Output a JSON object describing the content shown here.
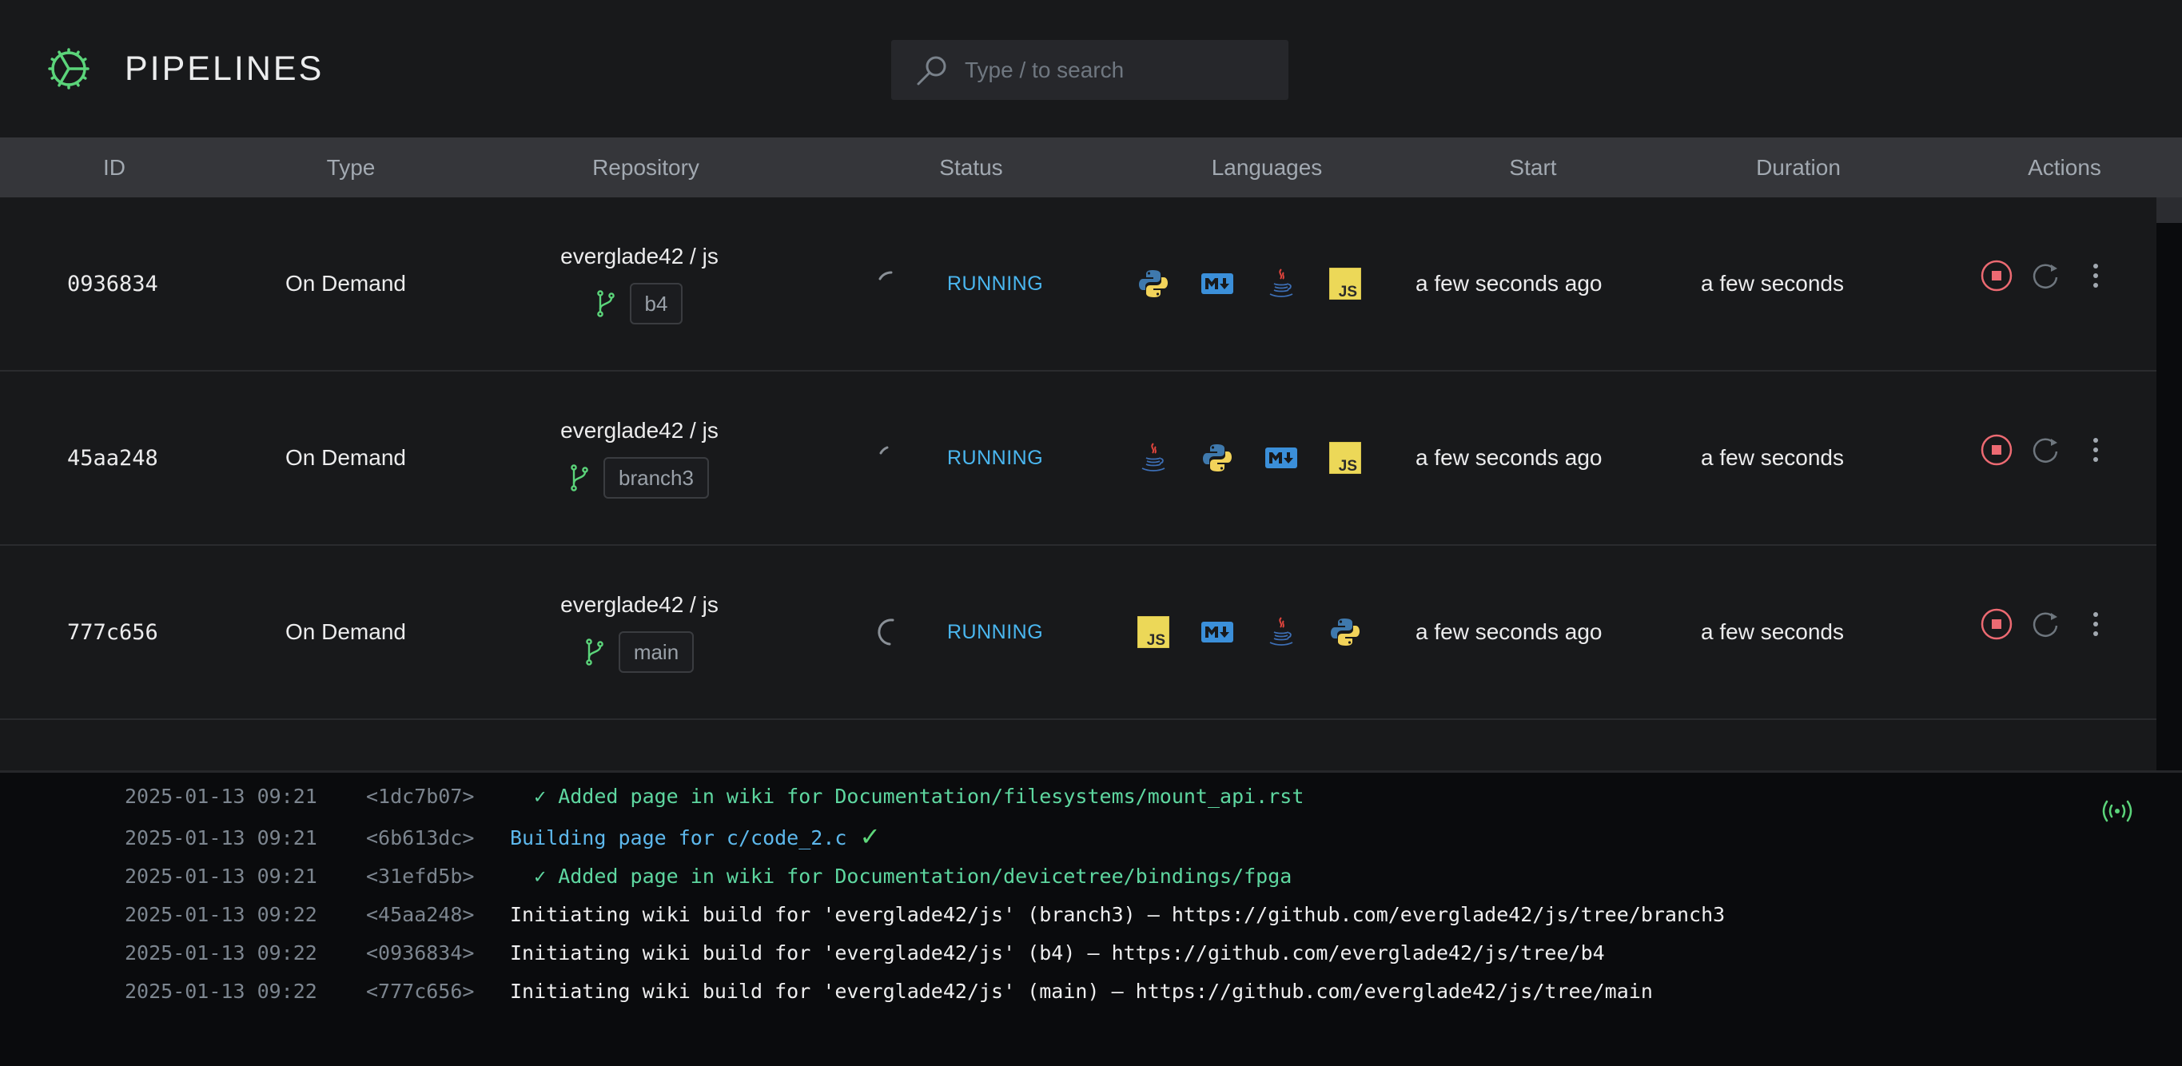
{
  "app": {
    "title": "PIPELINES",
    "logo_icon": "gear-icon",
    "accent_color": "#5bd47a"
  },
  "search": {
    "placeholder": "Type / to search",
    "value": "",
    "icon": "search-icon"
  },
  "table": {
    "columns": [
      "ID",
      "Type",
      "Repository",
      "Status",
      "Languages",
      "Start",
      "Duration",
      "Actions"
    ],
    "rows": [
      {
        "id": "0936834",
        "type": "On Demand",
        "repository": "everglade42 / js",
        "branch": "b4",
        "status": "RUNNING",
        "languages": [
          "python",
          "markdown",
          "java",
          "javascript"
        ],
        "start": "a few seconds ago",
        "duration": "a few seconds"
      },
      {
        "id": "45aa248",
        "type": "On Demand",
        "repository": "everglade42 / js",
        "branch": "branch3",
        "status": "RUNNING",
        "languages": [
          "java",
          "python",
          "markdown",
          "javascript"
        ],
        "start": "a few seconds ago",
        "duration": "a few seconds"
      },
      {
        "id": "777c656",
        "type": "On Demand",
        "repository": "everglade42 / js",
        "branch": "main",
        "status": "RUNNING",
        "languages": [
          "javascript",
          "markdown",
          "java",
          "python"
        ],
        "start": "a few seconds ago",
        "duration": "a few seconds"
      }
    ],
    "actions": [
      "stop-icon",
      "restart-icon",
      "more-vertical-icon"
    ],
    "status_color": "#4ab6ef",
    "stop_color": "#ec6a72"
  },
  "log": {
    "live_icon": "broadcast-icon",
    "lines": [
      {
        "timestamp": "2025-01-13 09:21",
        "id": "<1dc7b07>",
        "message": "  ✓ Added page in wiki for Documentation/filesystems/mount_api.rst",
        "style": "green",
        "check": ""
      },
      {
        "timestamp": "2025-01-13 09:21",
        "id": "<6b613dc>",
        "message": "Building page for c/code_2.c",
        "style": "blue",
        "check": "✓"
      },
      {
        "timestamp": "2025-01-13 09:21",
        "id": "<31efd5b>",
        "message": "  ✓ Added page in wiki for Documentation/devicetree/bindings/fpga",
        "style": "green",
        "check": ""
      },
      {
        "timestamp": "2025-01-13 09:22",
        "id": "<45aa248>",
        "message": "Initiating wiki build for 'everglade42/js' (branch3) – https://github.com/everglade42/js/tree/branch3",
        "style": "white",
        "check": ""
      },
      {
        "timestamp": "2025-01-13 09:22",
        "id": "<0936834>",
        "message": "Initiating wiki build for 'everglade42/js' (b4) – https://github.com/everglade42/js/tree/b4",
        "style": "white",
        "check": ""
      },
      {
        "timestamp": "2025-01-13 09:22",
        "id": "<777c656>",
        "message": "Initiating wiki build for 'everglade42/js' (main) – https://github.com/everglade42/js/tree/main",
        "style": "white",
        "check": ""
      }
    ]
  }
}
